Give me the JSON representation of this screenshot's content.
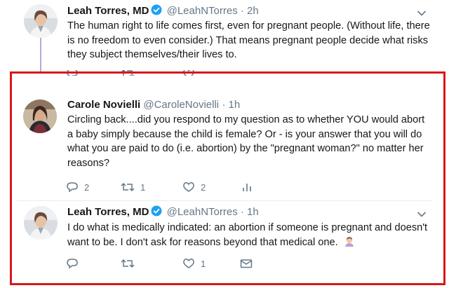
{
  "colors": {
    "highlight_border": "#d8171d",
    "thread_line": "#b9a6df",
    "verified_blue": "#1da1f2",
    "secondary_text": "#657786"
  },
  "tweets": [
    {
      "name": "Leah Torres, MD",
      "verified": true,
      "handle": "@LeahNTorres",
      "separator": "·",
      "time": "2h",
      "text": "The human right to life comes first, even for pregnant people. (Without life, there is no freedom to even consider.) That means pregnant people decide what risks they subject themselves/their lives to.",
      "icons": [
        "reply-icon",
        "retweet-icon",
        "like-icon",
        "message-icon"
      ]
    },
    {
      "name": "Carole Novielli",
      "verified": false,
      "handle": "@CaroleNovielli",
      "separator": "·",
      "time": "1h",
      "text": "Circling back....did you respond to my question as to whether YOU would abort a baby simply because the child is female? Or - is your answer that you will do what you are paid to do (i.e. abortion) by the \"pregnant woman?\"  no matter her reasons?",
      "actions": {
        "replies": "2",
        "retweets": "1",
        "likes": "2"
      },
      "icons": [
        "reply-icon",
        "retweet-icon",
        "like-icon",
        "analytics-icon"
      ]
    },
    {
      "name": "Leah Torres, MD",
      "verified": true,
      "handle": "@LeahNTorres",
      "separator": "·",
      "time": "1h",
      "text": "I do what is medically indicated: an abortion if someone is pregnant and doesn't want to be. I don't ask for reasons beyond that medical one.",
      "emoji": "woman-shrugging-emoji",
      "actions": {
        "replies": "",
        "retweets": "",
        "likes": "1"
      },
      "icons": [
        "reply-icon",
        "retweet-icon",
        "like-icon",
        "message-icon"
      ]
    }
  ]
}
